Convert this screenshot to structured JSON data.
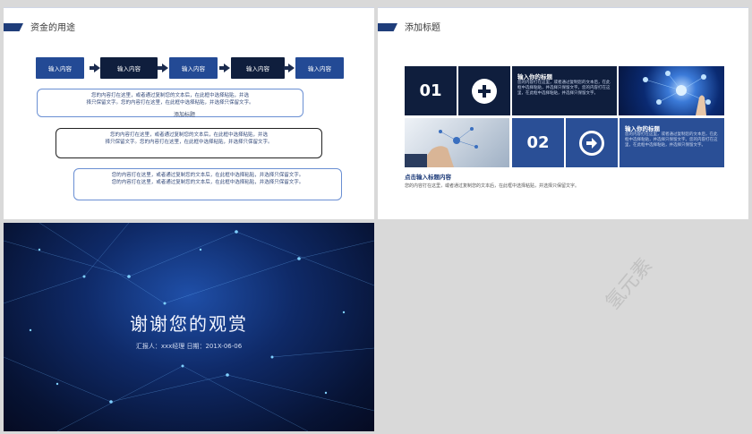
{
  "slide1": {
    "title": "资金的用途",
    "flow": [
      "输入内容",
      "输入内容",
      "输入内容",
      "输入内容",
      "输入内容"
    ],
    "boxes": [
      {
        "line1": "您的内容打在这里，或者通过复制您的文本后，在此框中选择粘贴，并选",
        "line2": "择只保留文字。您的内容打在这里，在此框中选择粘贴，并选择只保留文字。"
      },
      {
        "line1": "您的内容打在这里，或者通过复制您的文本后，在此框中选择粘贴，并选",
        "line2": "择只保留文字。您的内容打在这里，在此框中选择粘贴，并选择只保留文字。"
      },
      {
        "line1": "您的内容打在这里，或者通过复制您的文本后，在此框中选择粘贴，并选择只保留文字。",
        "line2": "您的内容打在这里，或者通过复制您的文本后，在此框中选择粘贴，并选择只保留文字。"
      }
    ],
    "label": "添加标题"
  },
  "slide2": {
    "title": "添加标题",
    "num1": "01",
    "num2": "02",
    "card1": {
      "title": "输入你的标题",
      "text": "您的内容打在这里，或者通过复制您的文本后，在此框中选择粘贴，并选择只保留文字。您的内容打在这里，在此框中选择粘贴，并选择只保留文字。"
    },
    "card2": {
      "title": "输入你的标题",
      "text": "您的内容打在这里，或者通过复制您的文本后，在此框中选择粘贴，并选择只保留文字。您的内容打在这里，在此框中选择粘贴，并选择只保留文字。"
    },
    "sub_title": "点击输入标题内容",
    "sub_text": "您的内容打在这里，或者通过复制您的文本后，在此框中选择粘贴，并选择只保留文字。"
  },
  "slide3": {
    "thanks": "谢谢您的观赏",
    "reporter": "汇报人：xxx经理  日期：201X-06-06"
  },
  "watermark": "氢元素",
  "colors": {
    "navy": "#0f1e3d",
    "blue": "#234a95",
    "bg": "#d9d9d9"
  }
}
